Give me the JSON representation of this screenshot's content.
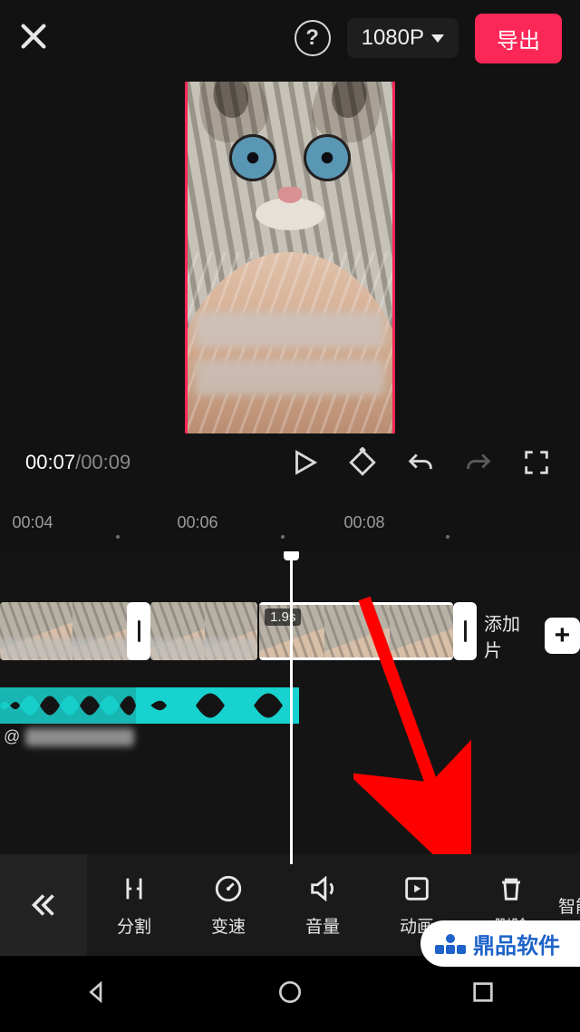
{
  "header": {
    "resolution": "1080P",
    "export_label": "导出"
  },
  "playback": {
    "current": "00:07",
    "total": "00:09"
  },
  "ruler": {
    "ticks": [
      "00:04",
      "00:06",
      "00:08"
    ]
  },
  "timeline": {
    "selected_clip_duration": "1.9s",
    "add_clip_label": "添加片",
    "audio_prefix": "@"
  },
  "toolbar": {
    "items": [
      {
        "id": "split",
        "label": "分割"
      },
      {
        "id": "speed",
        "label": "变速"
      },
      {
        "id": "volume",
        "label": "音量"
      },
      {
        "id": "anim",
        "label": "动画"
      },
      {
        "id": "delete",
        "label": "删除"
      },
      {
        "id": "smart",
        "label": "智能"
      }
    ]
  },
  "watermark": {
    "text": "鼎品软件"
  }
}
